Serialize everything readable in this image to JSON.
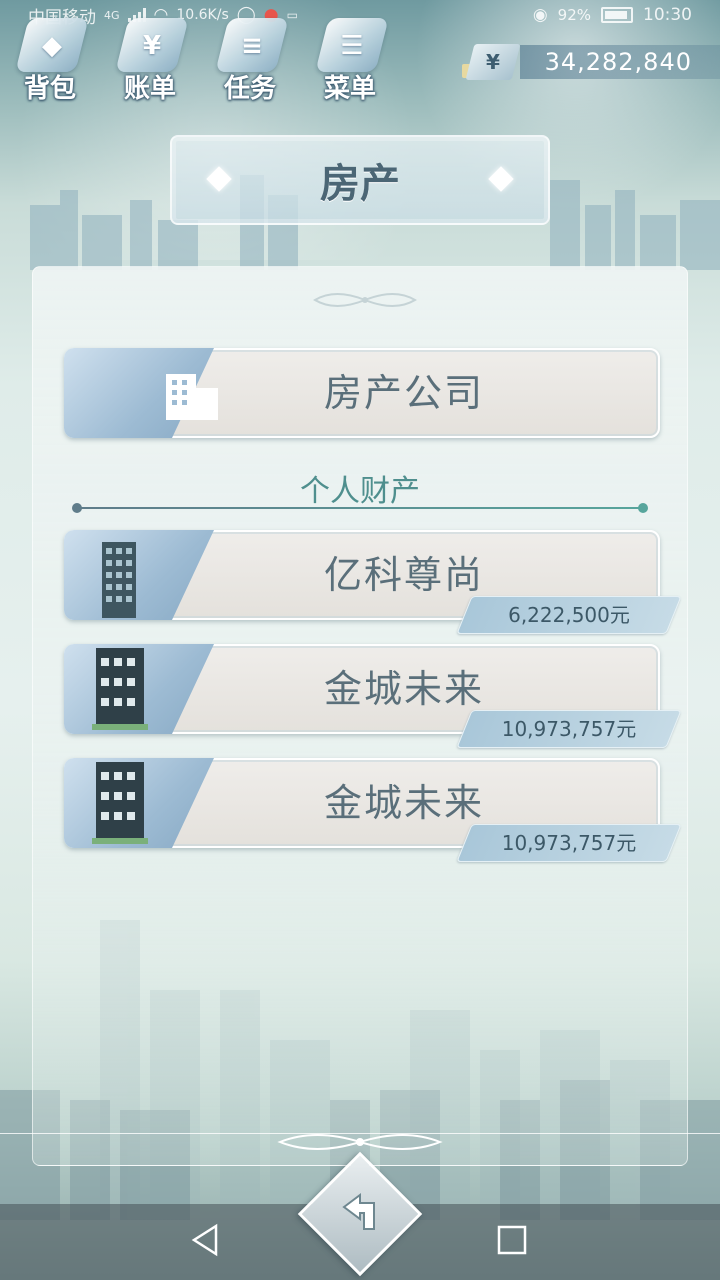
{
  "status_bar": {
    "carrier": "中国移动",
    "network": "4G",
    "speed": "10.6K/s",
    "battery": "92%",
    "time": "10:30"
  },
  "top_nav": {
    "items": [
      {
        "label": "背包",
        "glyph": "◆"
      },
      {
        "label": "账单",
        "glyph": "¥"
      },
      {
        "label": "任务",
        "glyph": "≡"
      },
      {
        "label": "菜单",
        "glyph": "☰"
      }
    ]
  },
  "balance": {
    "currency_symbol": "¥",
    "amount": "34,282,840"
  },
  "page_title": "房产",
  "company": {
    "label": "房产公司"
  },
  "personal_section": {
    "title": "个人财产"
  },
  "properties": [
    {
      "name": "亿科尊尚",
      "price": "6,222,500元"
    },
    {
      "name": "金城未来",
      "price": "10,973,757元"
    },
    {
      "name": "金城未来",
      "price": "10,973,757元"
    }
  ],
  "icons": {
    "back": "back-arrow-icon",
    "triangle": "back-nav-icon",
    "circle": "home-nav-icon",
    "square": "recents-nav-icon"
  }
}
